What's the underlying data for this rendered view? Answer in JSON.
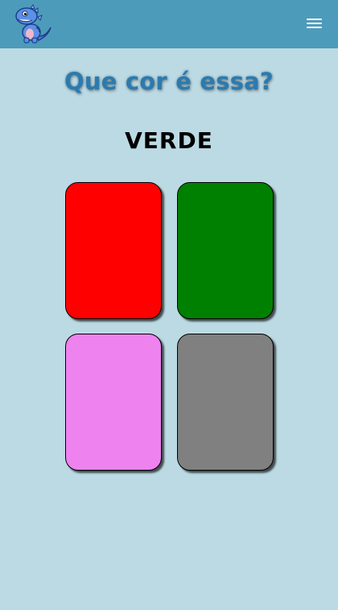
{
  "header": {
    "logo_icon": "blue-dinosaur-logo",
    "menu_icon": "hamburger-menu-icon",
    "background": "#4d9bba"
  },
  "game": {
    "title": "Que cor é essa?",
    "target_color_word": "VERDE",
    "cards": [
      {
        "color_name": "red",
        "color": "#ff0000"
      },
      {
        "color_name": "green",
        "color": "#008000"
      },
      {
        "color_name": "violet",
        "color": "#ee82ee"
      },
      {
        "color_name": "gray",
        "color": "#808080"
      }
    ]
  },
  "page_background": "#bcdae4"
}
